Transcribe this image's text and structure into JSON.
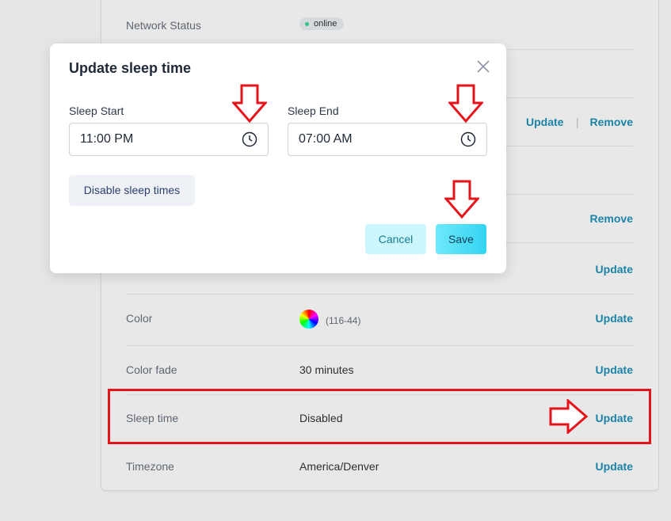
{
  "settings": {
    "network_status_label": "Network Status",
    "network_status_value": "online",
    "row_actions": {
      "update": "Update",
      "separator": "|",
      "remove": "Remove"
    },
    "color_label": "Color",
    "color_value": "(116-44)",
    "color_fade_label": "Color fade",
    "color_fade_value": "30 minutes",
    "sleep_time_label": "Sleep time",
    "sleep_time_value": "Disabled",
    "timezone_label": "Timezone",
    "timezone_value": "America/Denver"
  },
  "modal": {
    "title": "Update sleep time",
    "sleep_start_label": "Sleep Start",
    "sleep_start_value": "11:00 PM",
    "sleep_end_label": "Sleep End",
    "sleep_end_value": "07:00 AM",
    "disable_button": "Disable sleep times",
    "cancel_button": "Cancel",
    "save_button": "Save"
  },
  "colors": {
    "accent": "#1a83a7",
    "annotation": "#e5141b",
    "online_dot": "#2fc98e"
  }
}
